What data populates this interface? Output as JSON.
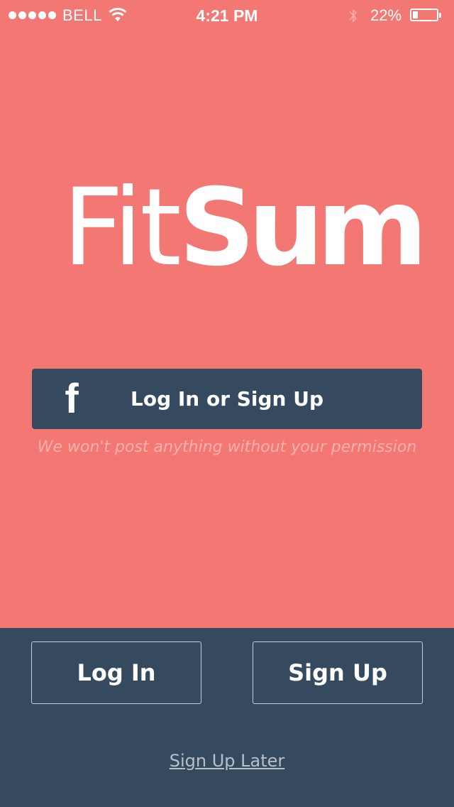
{
  "status_bar": {
    "carrier": "BELL",
    "time": "4:21 PM",
    "battery_percent": "22%",
    "battery_level": 0.22,
    "signal_dots": 5,
    "icons": [
      "signal-dots-icon",
      "wifi-icon",
      "bluetooth-icon",
      "battery-icon"
    ]
  },
  "logo": {
    "part_light": "Fit",
    "part_bold": "Sum"
  },
  "facebook": {
    "icon": "f",
    "label": "Log In or Sign Up",
    "note": "We won't post anything without your permission"
  },
  "actions": {
    "login_label": "Log In",
    "signup_label": "Sign Up",
    "later_label": "Sign Up Later"
  },
  "colors": {
    "background": "#f37773",
    "panel": "#354a5f",
    "text": "#ffffff"
  }
}
